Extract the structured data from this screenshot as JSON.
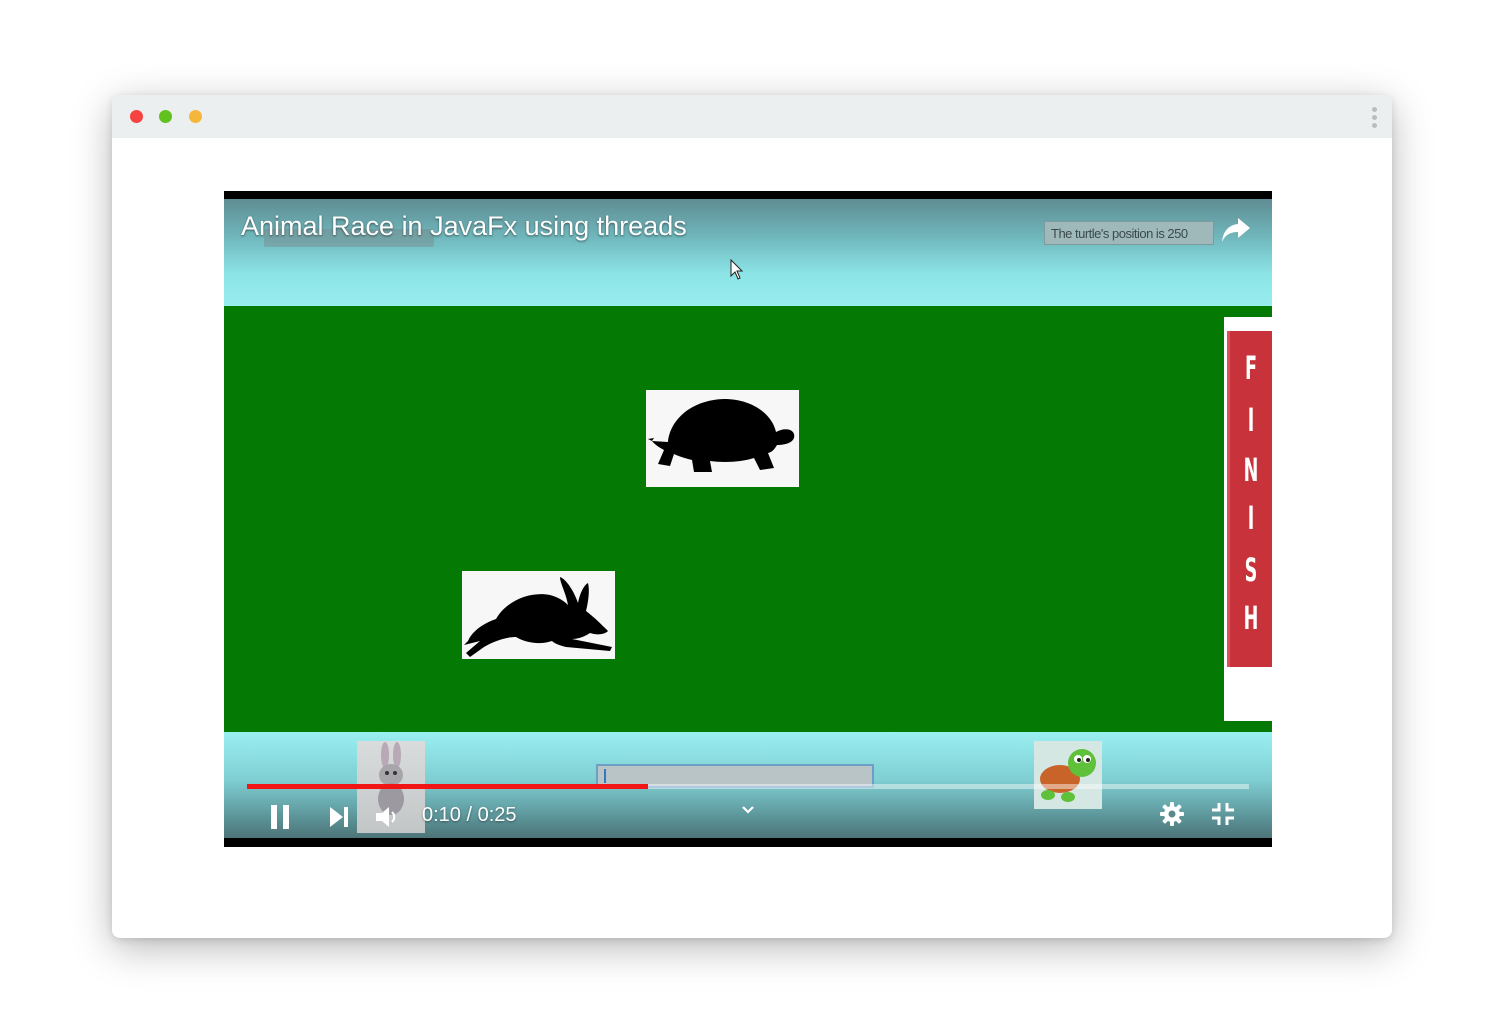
{
  "window": {
    "controls": [
      "close",
      "minimize",
      "maximize"
    ]
  },
  "video": {
    "title": "Animal Race in JavaFx using threads",
    "status_text": "The turtle's position is 250",
    "finish_letters": [
      "F",
      "I",
      "N",
      "I",
      "S",
      "H"
    ],
    "time_current": "0:10",
    "time_total": "0:25",
    "time_display": "0:10 / 0:25",
    "progress_fraction": 0.4
  },
  "icons": {
    "share": "share-arrow-icon",
    "pause": "pause-icon",
    "next": "skip-next-icon",
    "volume": "volume-icon",
    "chevron": "chevron-down-icon",
    "settings": "gear-icon",
    "exit_fullscreen": "exit-fullscreen-icon"
  },
  "colors": {
    "field": "#047a04",
    "sky": "#8ce4e7",
    "progress": "#f21515",
    "finish_banner": "#c8333b"
  }
}
